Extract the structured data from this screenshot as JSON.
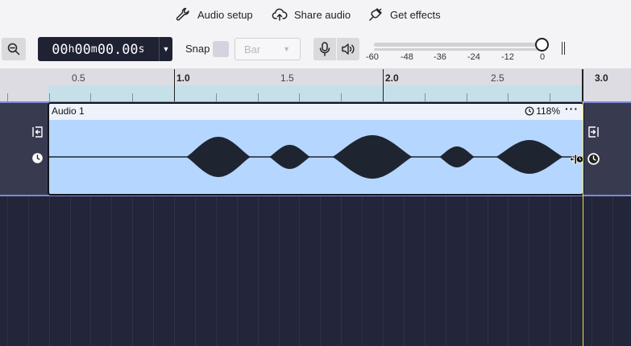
{
  "toolbar": {
    "audio_setup_label": "Audio setup",
    "share_audio_label": "Share audio",
    "get_effects_label": "Get effects"
  },
  "transport": {
    "time_h": "00",
    "time_h_unit": "h",
    "time_m": "00",
    "time_m_unit": "m",
    "time_s": "00.00",
    "time_s_unit": "s",
    "snap_label": "Snap",
    "snap_value": "Bar",
    "meter_labels": [
      "-60",
      "-48",
      "-36",
      "-24",
      "-12",
      "0"
    ]
  },
  "ruler": {
    "labels": [
      {
        "text": "0.5",
        "major": false
      },
      {
        "text": "1.0",
        "major": true
      },
      {
        "text": "1.5",
        "major": false
      },
      {
        "text": "2.0",
        "major": true
      },
      {
        "text": "2.5",
        "major": false
      },
      {
        "text": "3.0",
        "major": true
      }
    ]
  },
  "clip": {
    "title": "Audio 1",
    "speed": "118%",
    "more": "···"
  },
  "colors": {
    "clip_fill": "#b5d6fe",
    "track_bg": "#23253a",
    "playhead": "#f0e040",
    "selection": "#c6e0ea"
  }
}
